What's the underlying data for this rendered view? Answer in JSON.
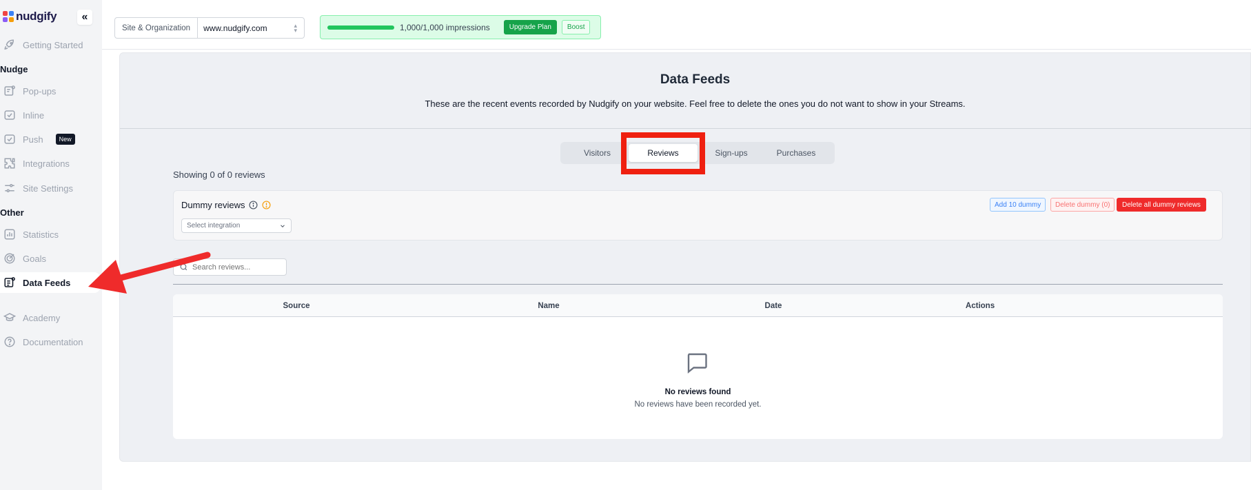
{
  "brand": {
    "name": "nudgify",
    "colors": [
      "#ef4444",
      "#3b82f6",
      "#8b5cf6",
      "#f59e0b"
    ]
  },
  "sidebar": {
    "collapse_icon": "«",
    "items_top": [
      {
        "label": "Getting Started",
        "icon": "rocket-icon"
      }
    ],
    "section_nudge": "Nudge",
    "nudge_items": [
      {
        "label": "Pop-ups",
        "icon": "popup-icon"
      },
      {
        "label": "Inline",
        "icon": "inline-icon"
      },
      {
        "label": "Push",
        "icon": "push-icon",
        "badge": "New"
      },
      {
        "label": "Integrations",
        "icon": "puzzle-icon"
      },
      {
        "label": "Site Settings",
        "icon": "sliders-icon"
      }
    ],
    "section_other": "Other",
    "other_items": [
      {
        "label": "Statistics",
        "icon": "chart-icon"
      },
      {
        "label": "Goals",
        "icon": "target-icon"
      },
      {
        "label": "Data Feeds",
        "icon": "feed-icon",
        "active": true
      }
    ],
    "bottom_items": [
      {
        "label": "Academy",
        "icon": "graduation-cap-icon"
      },
      {
        "label": "Documentation",
        "icon": "help-circle-icon"
      }
    ]
  },
  "topbar": {
    "site_label": "Site & Organization",
    "site_value": "www.nudgify.com",
    "impressions_text": "1,000/1,000 impressions",
    "impressions_progress": 1.0,
    "upgrade_label": "Upgrade Plan",
    "boost_label": "Boost"
  },
  "page": {
    "title": "Data Feeds",
    "description": "These are the recent events recorded by Nudgify on your website. Feel free to delete the ones you do not want to show in your Streams."
  },
  "tabs": [
    {
      "label": "Visitors",
      "active": false
    },
    {
      "label": "Reviews",
      "active": true
    },
    {
      "label": "Sign-ups",
      "active": false
    },
    {
      "label": "Purchases",
      "active": false
    }
  ],
  "showing_text": "Showing 0 of 0 reviews",
  "dummy": {
    "title": "Dummy reviews",
    "select_placeholder": "Select integration",
    "add_label": "Add 10 dummy",
    "delete_label": "Delete dummy (0)",
    "delete_all_label": "Delete all dummy reviews"
  },
  "search": {
    "placeholder": "Search reviews..."
  },
  "table": {
    "columns": [
      "Source",
      "Name",
      "Date",
      "Actions"
    ],
    "rows": [],
    "empty_title": "No reviews found",
    "empty_subtitle": "No reviews have been recorded yet."
  },
  "annotation_color": "#ef2010"
}
